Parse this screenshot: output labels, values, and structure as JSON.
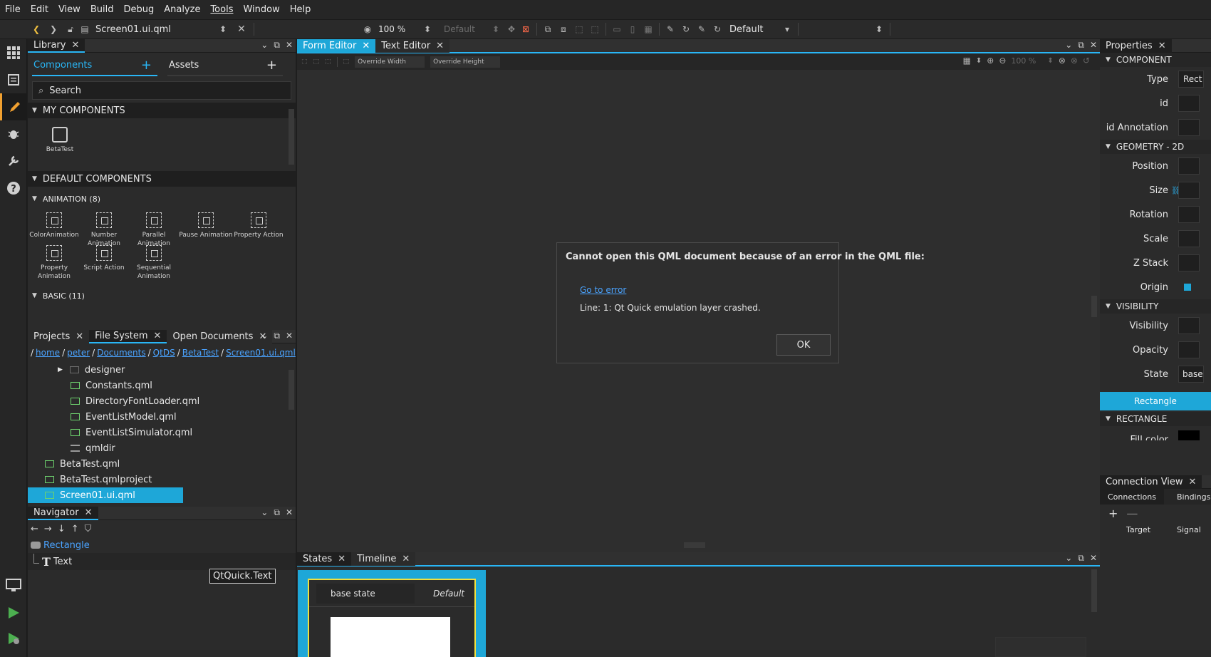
{
  "menu": [
    "File",
    "Edit",
    "View",
    "Build",
    "Debug",
    "Analyze",
    "Tools",
    "Window",
    "Help"
  ],
  "toolbar": {
    "document": "Screen01.ui.qml",
    "zoom": "100 %",
    "style_default": "Default",
    "theme_default": "Default"
  },
  "library": {
    "title": "Library",
    "tab_components": "Components",
    "tab_assets": "Assets",
    "search_placeholder": "Search",
    "my_components": "MY COMPONENTS",
    "my_items": [
      "BetaTest"
    ],
    "default_components": "DEFAULT COMPONENTS",
    "animation_header": "ANIMATION (8)",
    "animation_items": [
      {
        "line1": "ColorAnimation",
        "line2": ""
      },
      {
        "line1": "Number",
        "line2": "Animation"
      },
      {
        "line1": "Parallel",
        "line2": "Animation"
      },
      {
        "line1": "Pause Animation",
        "line2": ""
      },
      {
        "line1": "Property Action",
        "line2": ""
      },
      {
        "line1": "Property",
        "line2": "Animation"
      },
      {
        "line1": "Script Action",
        "line2": ""
      },
      {
        "line1": "Sequential",
        "line2": "Animation"
      }
    ],
    "basic_header": "BASIC (11)"
  },
  "files": {
    "tabs": [
      "Projects",
      "File System",
      "Open Documents"
    ],
    "breadcrumb": [
      "home",
      "peter",
      "Documents",
      "QtDS",
      "BetaTest",
      "Screen01.ui.qml"
    ],
    "rows": [
      {
        "name": "designer",
        "type": "dir",
        "indent": 2
      },
      {
        "name": "Constants.qml",
        "type": "file",
        "indent": 2
      },
      {
        "name": "DirectoryFontLoader.qml",
        "type": "file",
        "indent": 2
      },
      {
        "name": "EventListModel.qml",
        "type": "file",
        "indent": 2
      },
      {
        "name": "EventListSimulator.qml",
        "type": "file",
        "indent": 2
      },
      {
        "name": "qmldir",
        "type": "text",
        "indent": 2
      },
      {
        "name": "BetaTest.qml",
        "type": "file",
        "indent": 1
      },
      {
        "name": "BetaTest.qmlproject",
        "type": "file",
        "indent": 1
      },
      {
        "name": "Screen01.ui.qml",
        "type": "file",
        "indent": 1,
        "selected": true
      }
    ]
  },
  "navigator": {
    "title": "Navigator",
    "root": "Rectangle",
    "child": "Text",
    "tooltip": "QtQuick.Text"
  },
  "editor": {
    "tabs": [
      "Form Editor",
      "Text Editor"
    ],
    "override_width": "Override Width",
    "override_height": "Override Height",
    "zoom": "100 %"
  },
  "dialog": {
    "message": "Cannot open this QML document because of an error in the QML file:",
    "link": "Go to error",
    "detail": "Line: 1: Qt Quick emulation layer crashed.",
    "ok": "OK"
  },
  "states": {
    "tabs": [
      "States",
      "Timeline"
    ],
    "base_state": "base state",
    "default_label": "Default"
  },
  "properties": {
    "title": "Properties",
    "component_header": "COMPONENT",
    "type_label": "Type",
    "type_value": "Rect",
    "id_label": "id",
    "id_annotation": "id Annotation",
    "geometry_header": "GEOMETRY - 2D",
    "geometry_rows": [
      "Position",
      "Size",
      "Rotation",
      "Scale",
      "Z Stack",
      "Origin"
    ],
    "visibility_header": "VISIBILITY",
    "visibility_rows": [
      "Visibility",
      "Opacity",
      "State"
    ],
    "state_value": "base",
    "rectangle_bar": "Rectangle",
    "rectangle_header": "RECTANGLE",
    "fill_color": "Fill color"
  },
  "connections": {
    "title": "Connection View",
    "tabs": [
      "Connections",
      "Bindings"
    ],
    "col_target": "Target",
    "col_signal": "Signal"
  },
  "colors": {
    "accent": "#29b6f6",
    "selection": "#1ea7d8",
    "link": "#4aa3ff",
    "file_green": "#6ed36e",
    "run_green": "#4caf50",
    "pencil_orange": "#f0a030"
  }
}
